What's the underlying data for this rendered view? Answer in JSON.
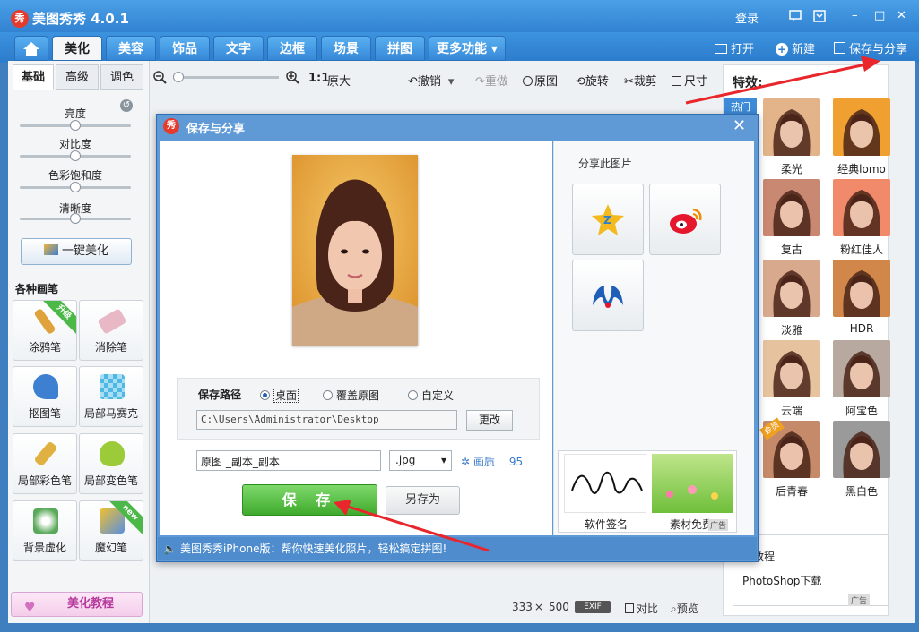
{
  "window": {
    "logo_text": "秀",
    "title": "美图秀秀 4.0.1",
    "login": "登录",
    "min": "–",
    "max": "□",
    "close": "✕"
  },
  "tabs": [
    {
      "label": "美化",
      "active": true
    },
    {
      "label": "美容"
    },
    {
      "label": "饰品"
    },
    {
      "label": "文字"
    },
    {
      "label": "边框"
    },
    {
      "label": "场景"
    },
    {
      "label": "拼图"
    },
    {
      "label": "更多功能 ▾"
    }
  ],
  "top_actions": {
    "open": "打开",
    "new": "新建",
    "save_share": "保存与分享"
  },
  "left": {
    "tabs": [
      "基础",
      "高级",
      "调色"
    ],
    "sliders": [
      {
        "label": "亮度",
        "value": 0.5
      },
      {
        "label": "对比度",
        "value": 0.5
      },
      {
        "label": "色彩饱和度",
        "value": 0.5
      },
      {
        "label": "清晰度",
        "value": 0.5
      }
    ],
    "one_key": "一键美化",
    "brush_title": "各种画笔",
    "brushes": [
      {
        "label": "涂鸦笔",
        "badge": "升级",
        "color": "#e0a23a"
      },
      {
        "label": "消除笔",
        "badge": "",
        "color": "#e9b8c6"
      },
      {
        "label": "抠图笔",
        "badge": "",
        "color": "#3d7fd0"
      },
      {
        "label": "局部马赛克",
        "badge": "",
        "color": "#4fb7e3"
      },
      {
        "label": "局部彩色笔",
        "badge": "",
        "color": "#e0b040"
      },
      {
        "label": "局部变色笔",
        "badge": "",
        "color": "#9ccb3a"
      },
      {
        "label": "背景虚化",
        "badge": "",
        "color": "#5aa95a"
      },
      {
        "label": "魔幻笔",
        "badge": "new",
        "color": "#5a8fe0"
      }
    ],
    "tutorial": "美化教程"
  },
  "toolbar": {
    "zoom_label": "1:1",
    "original_size": "原大",
    "undo": "撤销",
    "redo": "重做",
    "original": "原图",
    "rotate": "旋转",
    "crop": "裁剪",
    "size": "尺寸"
  },
  "effects": {
    "title": "特效:",
    "hot_tab": "热门",
    "items": [
      {
        "label": "柔光",
        "color": "#e3b48a"
      },
      {
        "label": "经典lomo",
        "color": "#f0a030"
      },
      {
        "label": "复古",
        "color": "#c98872"
      },
      {
        "label": "粉红佳人",
        "color": "#f08a6a"
      },
      {
        "label": "淡雅",
        "color": "#d9a98d"
      },
      {
        "label": "HDR",
        "color": "#d2874a"
      },
      {
        "label": "云端",
        "color": "#e6c29e"
      },
      {
        "label": "阿宝色",
        "color": "#b7a9a0"
      },
      {
        "label": "后青春",
        "color": "#c48a6a"
      },
      {
        "label": "黑白色",
        "color": "#9a9a9a"
      }
    ],
    "corner_badge": "会员"
  },
  "status": {
    "width": "333",
    "times": "×",
    "height": "500",
    "exif": "EXIF",
    "compare": "对比",
    "preview": "预览"
  },
  "ad_panel2": {
    "line1": "教程",
    "line2": "PhotoShop下载",
    "ad_tag": "广告"
  },
  "dialog": {
    "logo_text": "秀",
    "title": "保存与分享",
    "close": "✕",
    "save_path_label": "保存路径",
    "options": [
      {
        "label": "桌面",
        "checked": true
      },
      {
        "label": "覆盖原图",
        "checked": false
      },
      {
        "label": "自定义",
        "checked": false
      }
    ],
    "path_value": "C:\\Users\\Administrator\\Desktop",
    "change_btn": "更改",
    "filename": "原图 _副本_副本",
    "extension": ".jpg",
    "quality_label": "画质",
    "quality_value": "95",
    "save_btn": "保 存",
    "save_as_btn": "另存为",
    "share_label": "分享此图片",
    "ad_left": "软件签名",
    "ad_right": "素材免费",
    "ad_tag": "广告",
    "footer": "美图秀秀iPhone版：帮你快速美化照片，轻松搞定拼图!"
  },
  "colors": {
    "accent": "#2f7fd0",
    "save_green": "#3faa2d",
    "arrow_red": "#e8262b"
  }
}
